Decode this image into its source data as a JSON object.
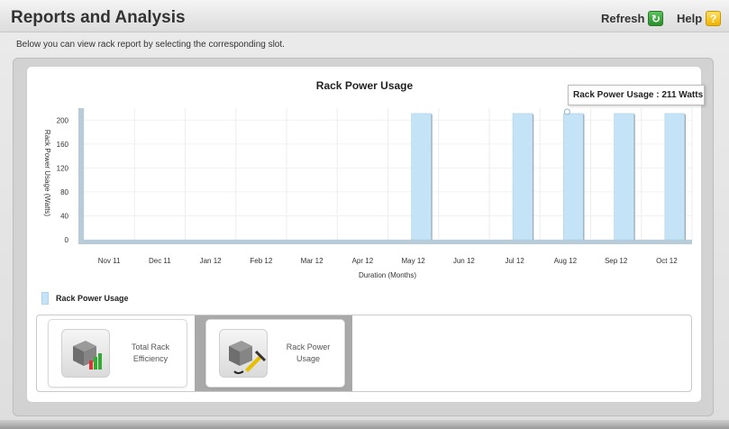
{
  "header": {
    "title": "Reports and Analysis",
    "refresh_label": "Refresh",
    "help_label": "Help"
  },
  "instructions": "Below you can view rack report by selecting the corresponding slot.",
  "tooltip": "Rack Power Usage : 211 Watts",
  "legend": {
    "label": "Rack Power Usage"
  },
  "slots": [
    {
      "line1": "Total Rack",
      "line2": "Efficiency"
    },
    {
      "line1": "Rack Power",
      "line2": "Usage"
    }
  ],
  "colors": {
    "bar": "#c5e3f6",
    "bar_border": "#a9cfe8",
    "baseline": "#b8cbd8"
  },
  "chart_data": {
    "type": "bar",
    "title": "Rack Power Usage",
    "xlabel": "Duration (Months)",
    "ylabel": "Rack Power Usage (Watts)",
    "categories": [
      "Nov 11",
      "Dec 11",
      "Jan 12",
      "Feb 12",
      "Mar 12",
      "Apr 12",
      "May 12",
      "Jun 12",
      "Jul 12",
      "Aug 12",
      "Sep 12",
      "Oct 12"
    ],
    "series": [
      {
        "name": "Rack Power Usage",
        "values": [
          0,
          0,
          0,
          0,
          0,
          0,
          211,
          0,
          211,
          211,
          211,
          211
        ]
      }
    ],
    "yticks": [
      0,
      40,
      80,
      120,
      160,
      200
    ],
    "ylim": [
      0,
      220
    ],
    "grid": true,
    "legend_position": "bottom-left"
  }
}
